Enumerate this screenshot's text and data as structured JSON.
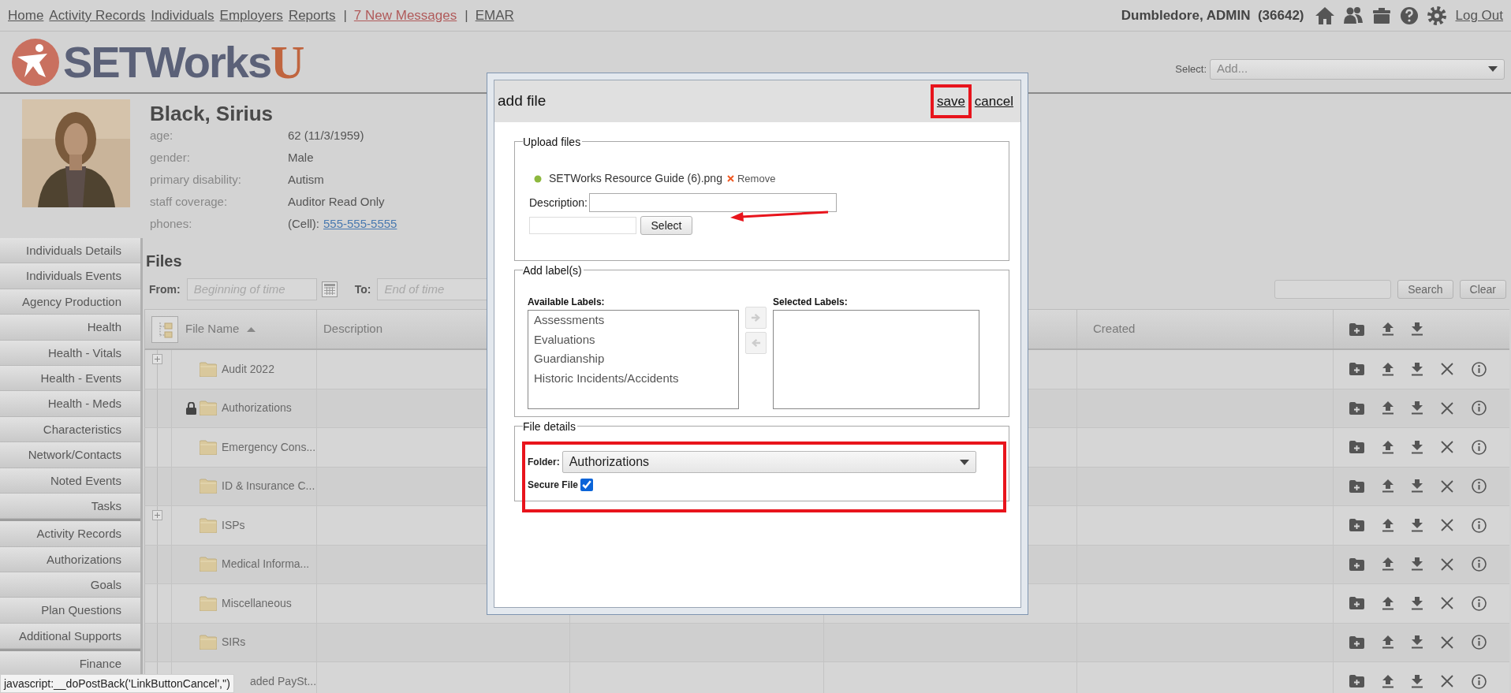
{
  "top_nav": {
    "links": [
      {
        "kind": "link",
        "text": "Home"
      },
      {
        "kind": "link",
        "text": "Activity Records"
      },
      {
        "kind": "link",
        "text": "Individuals"
      },
      {
        "kind": "link",
        "text": "Employers"
      },
      {
        "kind": "link",
        "text": "Reports"
      },
      {
        "kind": "separator",
        "text": "|"
      },
      {
        "kind": "alert",
        "text": "7 New Messages"
      },
      {
        "kind": "separator",
        "text": "|"
      },
      {
        "kind": "link",
        "text": "EMAR"
      }
    ],
    "user": "Dumbledore, ADMIN",
    "user_id": "(36642)",
    "logout": "Log Out"
  },
  "logo": {
    "name": "SETWorks",
    "suffix": "U"
  },
  "select": {
    "label": "Select:",
    "value": "Add..."
  },
  "profile": {
    "name": "Black, Sirius",
    "fields": [
      {
        "label": "age:",
        "value": "62 (11/3/1959)"
      },
      {
        "label": "gender:",
        "value": "Male"
      },
      {
        "label": "primary disability:",
        "value": "Autism"
      },
      {
        "label": "staff coverage:",
        "value": "Auditor Read Only"
      },
      {
        "label": "phones:",
        "value": "(Cell):",
        "link": "555-555-5555"
      }
    ]
  },
  "sidebar": {
    "groups": [
      [
        "Individuals Details",
        "Individuals Events",
        "Agency Production",
        "Health",
        "Health - Vitals",
        "Health - Events",
        "Health - Meds",
        "Characteristics",
        "Network/Contacts",
        "Noted Events",
        "Tasks"
      ],
      [
        "Activity Records",
        "Authorizations",
        "Goals",
        "Plan Questions",
        "Additional Supports"
      ],
      [
        "Finance"
      ]
    ]
  },
  "files": {
    "title": "Files",
    "from_label": "From:",
    "from_placeholder": "Beginning of time",
    "to_label": "To:",
    "to_placeholder": "End of time",
    "search_button": "Search",
    "clear_button": "Clear",
    "table": {
      "columns": [
        {
          "label": "File Name",
          "sorted": true
        },
        {
          "label": "Description",
          "sorted": false
        },
        {
          "label": "Created",
          "sorted": false
        }
      ],
      "rows": [
        {
          "kind": "folder",
          "name": "Audit 2022",
          "expandable": true,
          "locked": false
        },
        {
          "kind": "folder",
          "name": "Authorizations",
          "expandable": false,
          "locked": true
        },
        {
          "kind": "folder",
          "name": "Emergency Cons...",
          "expandable": false,
          "locked": false
        },
        {
          "kind": "folder",
          "name": "ID & Insurance C...",
          "expandable": false,
          "locked": false
        },
        {
          "kind": "folder",
          "name": "ISPs",
          "expandable": true,
          "locked": false
        },
        {
          "kind": "folder",
          "name": "Medical Informa...",
          "expandable": false,
          "locked": false
        },
        {
          "kind": "folder",
          "name": "Miscellaneous",
          "expandable": false,
          "locked": false
        },
        {
          "kind": "folder",
          "name": "SIRs",
          "expandable": false,
          "locked": false
        },
        {
          "kind": "covered",
          "name": "aded PaySt...",
          "expandable": false,
          "locked": false
        }
      ]
    }
  },
  "dialog": {
    "title": "add file",
    "save": "save",
    "cancel": "cancel",
    "upload": {
      "legend": "Upload files",
      "file_name": "SETWorks Resource Guide (6).png",
      "remove": "Remove",
      "description_label": "Description:",
      "select_button": "Select"
    },
    "labels": {
      "legend": "Add label(s)",
      "available_title": "Available Labels:",
      "available": [
        "Assessments",
        "Evaluations",
        "Guardianship",
        "Historic Incidents/Accidents"
      ],
      "selected_title": "Selected Labels:",
      "move_buttons": [
        {
          "kind": "add",
          "disabled": true
        },
        {
          "kind": "remove",
          "disabled": true
        }
      ]
    },
    "details": {
      "legend": "File details",
      "folder_label": "Folder:",
      "folder": "Authorizations",
      "secure_label": "Secure File",
      "secure": true
    }
  },
  "status_bar": "javascript:__doPostBack('LinkButtonCancel','')"
}
